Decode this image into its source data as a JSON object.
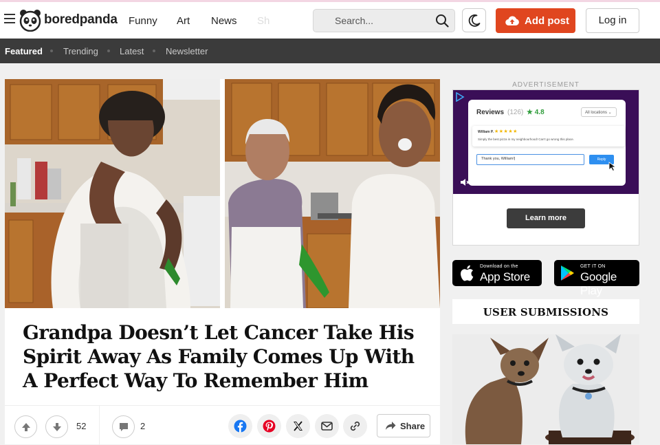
{
  "header": {
    "logo_text": "boredpanda",
    "nav": [
      "Funny",
      "Art",
      "News",
      "Sh"
    ],
    "search_placeholder": "Search...",
    "add_post_label": "Add post",
    "login_label": "Log in",
    "accent": "#e0461f"
  },
  "subnav": {
    "items": [
      "Featured",
      "Trending",
      "Latest",
      "Newsletter"
    ]
  },
  "article": {
    "title": "Grandpa Doesn’t Let Cancer Take His Spirit Away As Family Comes Up With A Perfect Way To Remember Him",
    "vote_count": "52",
    "comment_count": "2",
    "share_label": "Share"
  },
  "sidebar": {
    "ad_label": "ADVERTISEMENT",
    "ad": {
      "reviews_title": "Reviews",
      "reviews_count": "(126)",
      "rating": "★ 4.8",
      "location_select": "All locations ⌄",
      "reviewer": "William P.",
      "stars": "★★★★★",
      "review_text": "Simply the best pizza in my neighbourhood! Can't go wrong this place.",
      "reply_value": "Thank you, William!|",
      "reply_button": "Reply",
      "learn_more": "Learn more"
    },
    "app_store": {
      "small": "Download on the",
      "big": "App Store"
    },
    "google_play": {
      "small": "GET IT ON",
      "big": "Google Play"
    },
    "user_submissions": "USER SUBMISSIONS"
  }
}
